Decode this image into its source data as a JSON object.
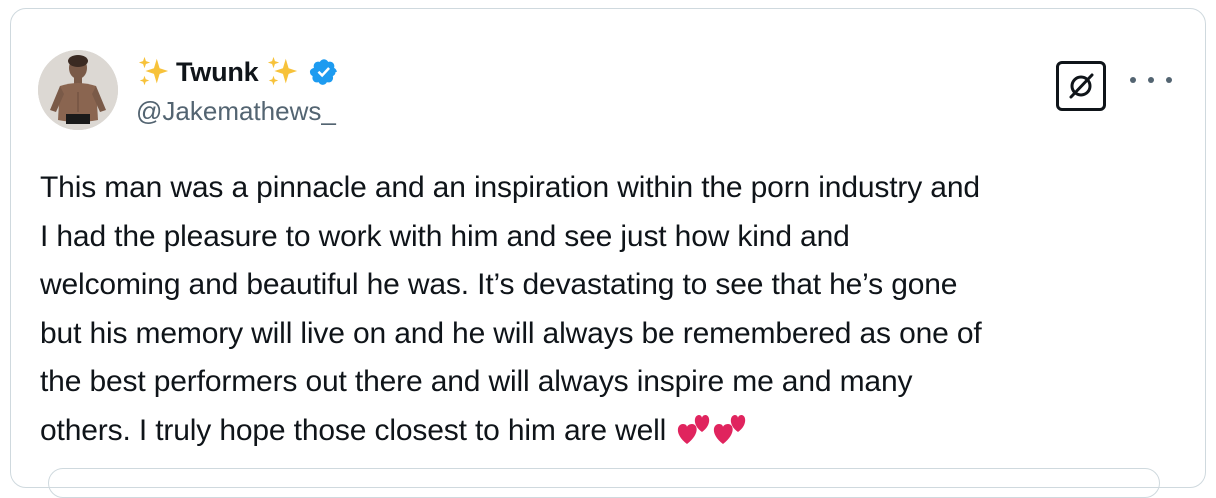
{
  "author": {
    "display_name": "Twunk",
    "handle": "@Jakemathews_",
    "verified": true,
    "name_emoji": "sparkles-icon",
    "badge_color": "#1d9bf0"
  },
  "tweet": {
    "lines": [
      "This man was a pinnacle and an inspiration within the porn industry and",
      "I had the pleasure to work with him and see just how kind and",
      "welcoming and beautiful he was. It’s devastating to see that he’s gone",
      "but his memory will live on and he will always be remembered as one of",
      "the best performers out there and will always inspire me and many",
      "others. I truly hope those closest to him are well"
    ],
    "trailing_emoji": [
      "two-hearts-icon",
      "two-hearts-icon"
    ]
  },
  "actions": {
    "grok_icon": "grok-icon",
    "more_icon": "more-horizontal-icon"
  },
  "colors": {
    "text": "#0f1419",
    "secondary": "#536471",
    "border": "#cfd9de",
    "heart": "#e0245e"
  }
}
